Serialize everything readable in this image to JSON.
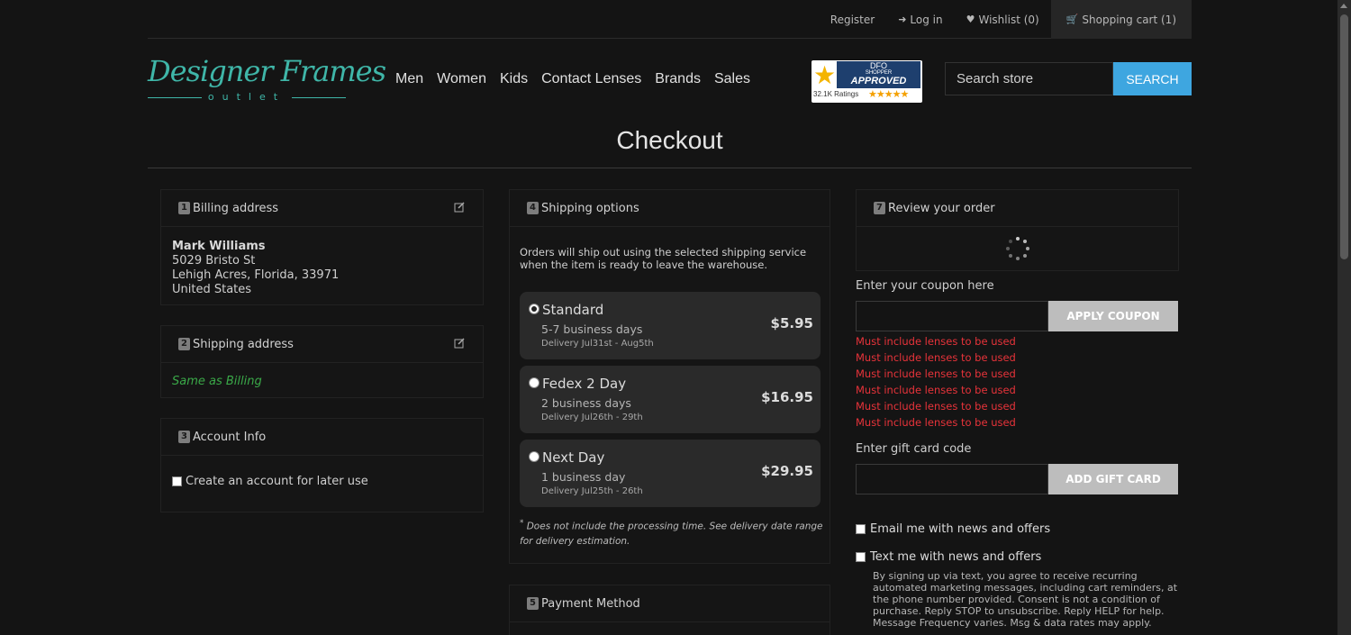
{
  "topbar": {
    "register": "Register",
    "login": "Log in",
    "wishlist": "Wishlist (0)",
    "cart": "Shopping cart (1)"
  },
  "logo": {
    "line1_a": "Designer",
    "line1_b": "Frames",
    "line2": "outlet"
  },
  "nav": [
    "Men",
    "Women",
    "Kids",
    "Contact Lenses",
    "Brands",
    "Sales"
  ],
  "badge": {
    "top1": "DFO",
    "top2": "SHOPPER",
    "top3": "APPROVED",
    "ratings": "32.1K Ratings",
    "stars": "★★★★★"
  },
  "search": {
    "placeholder": "Search store",
    "button": "SEARCH"
  },
  "page_title": "Checkout",
  "billing": {
    "num": "1",
    "title": "Billing address",
    "name": "Mark Williams",
    "street": "5029 Bristo St",
    "city": "Lehigh Acres, Florida, 33971",
    "country": "United States"
  },
  "shipping_addr": {
    "num": "2",
    "title": "Shipping address",
    "value": "Same as Billing"
  },
  "account": {
    "num": "3",
    "title": "Account Info",
    "checkbox_label": "Create an account for later use"
  },
  "shipping_options": {
    "num": "4",
    "title": "Shipping options",
    "note": "Orders will ship out using the selected shipping service when the item is ready to leave the warehouse.",
    "options": [
      {
        "name": "Standard",
        "days": "5-7 business days",
        "delivery": "Delivery Jul31st - Aug5th",
        "price": "$5.95",
        "selected": true
      },
      {
        "name": "Fedex 2 Day",
        "days": "2 business days",
        "delivery": "Delivery Jul26th - 29th",
        "price": "$16.95",
        "selected": false
      },
      {
        "name": "Next Day",
        "days": "1 business day",
        "delivery": "Delivery Jul25th - 26th",
        "price": "$29.95",
        "selected": false
      }
    ],
    "footnote": "Does not include the processing time. See delivery date range for delivery estimation."
  },
  "payment": {
    "num": "5",
    "title": "Payment Method"
  },
  "review": {
    "num": "7",
    "title": "Review your order"
  },
  "coupon": {
    "label": "Enter your coupon here",
    "button": "APPLY COUPON",
    "errors": [
      "Must include lenses to be used",
      "Must include lenses to be used",
      "Must include lenses to be used",
      "Must include lenses to be used",
      "Must include lenses to be used",
      "Must include lenses to be used"
    ]
  },
  "giftcard": {
    "label": "Enter gift card code",
    "button": "ADD GIFT CARD"
  },
  "optins": {
    "email": "Email me with news and offers",
    "text": "Text me with news and offers",
    "fine": "By signing up via text, you agree to receive recurring automated marketing messages, including cart reminders, at the phone number provided. Consent is not a condition of purchase. Reply STOP to unsubscribe. Reply HELP for help. Message Frequency varies. Msg & data rates may apply."
  },
  "colors": {
    "accent": "#3ea6e0",
    "brand": "#3fb6a8",
    "error": "#e8333a",
    "success": "#3aa848"
  }
}
